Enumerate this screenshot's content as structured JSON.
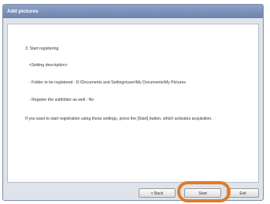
{
  "window": {
    "title": "Add pictures"
  },
  "content": {
    "step": "3. Start registering",
    "setting_desc": "<Setting description>",
    "folder": "- Folder to be registered :   D:\\Documents and Settings\\user\\My Documents\\My Pictures",
    "subfolder": "- Register the subfolder as well :   No",
    "instruction": "If you want to start registration using these settings, press the [Start] button, which activates acquisition."
  },
  "buttons": {
    "back": "< Back",
    "start": "Start",
    "exit": "Exit"
  }
}
